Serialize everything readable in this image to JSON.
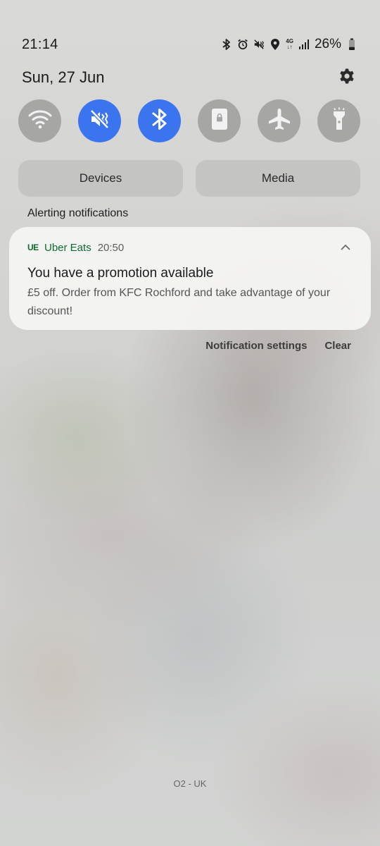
{
  "status_bar": {
    "time": "21:14",
    "network_label_top": "4G",
    "network_label_bottom": "↓↑",
    "battery_percent": "26%",
    "icons": [
      "bluetooth-icon",
      "alarm-icon",
      "mute-icon",
      "location-icon",
      "network-4g-icon",
      "signal-icon",
      "battery-icon"
    ]
  },
  "header": {
    "date": "Sun, 27 Jun"
  },
  "quick_toggles": [
    {
      "name": "wifi",
      "icon": "wifi-icon",
      "active": false
    },
    {
      "name": "mute",
      "icon": "mute-icon",
      "active": true
    },
    {
      "name": "bluetooth",
      "icon": "bluetooth-icon",
      "active": true
    },
    {
      "name": "portrait-lock",
      "icon": "portrait-lock-icon",
      "active": false
    },
    {
      "name": "airplane-mode",
      "icon": "airplane-icon",
      "active": false
    },
    {
      "name": "flashlight",
      "icon": "flashlight-icon",
      "active": false
    }
  ],
  "buttons": {
    "devices": "Devices",
    "media": "Media"
  },
  "section": {
    "label": "Alerting notifications"
  },
  "notification": {
    "app_logo": "UE",
    "app_name": "Uber Eats",
    "time": "20:50",
    "title": "You have a promotion available",
    "body": "£5 off. Order from KFC Rochford and take advantage of your discount!"
  },
  "actions": {
    "settings": "Notification settings",
    "clear": "Clear"
  },
  "carrier": "O2 - UK",
  "colors": {
    "accent_blue": "#3b74ef",
    "toggle_off": "#a6a6a4",
    "uber_green": "#0d6b2f"
  }
}
